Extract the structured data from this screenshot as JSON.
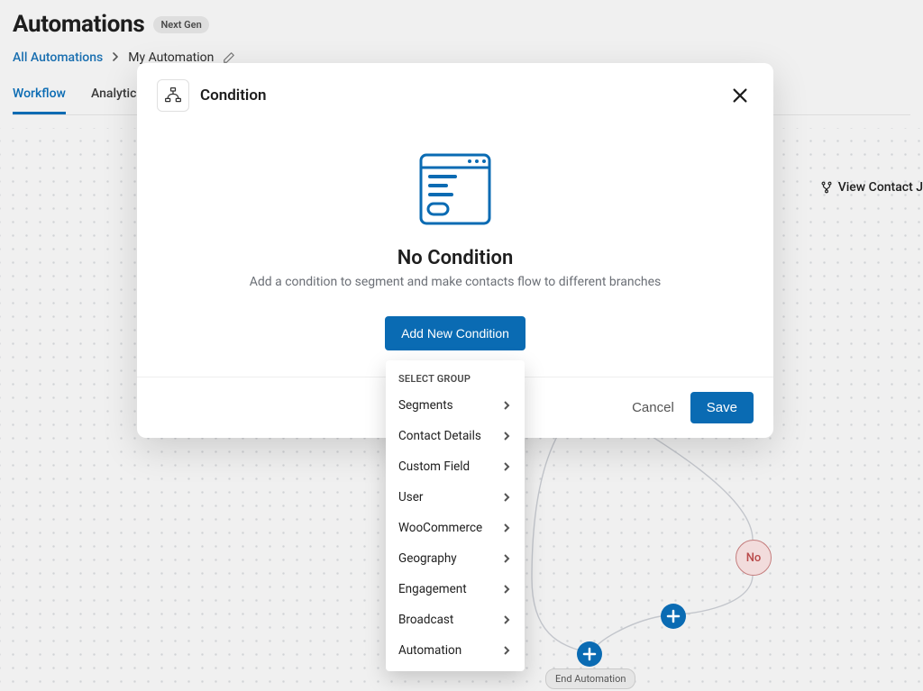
{
  "header": {
    "title": "Automations",
    "badge": "Next Gen"
  },
  "breadcrumb": {
    "root": "All Automations",
    "current": "My Automation"
  },
  "tabs": {
    "workflow": "Workflow",
    "analytics": "Analytics"
  },
  "toolbar": {
    "view_contact": "View Contact J"
  },
  "modal": {
    "title": "Condition",
    "empty_title": "No Condition",
    "empty_subtitle": "Add a condition to segment and make contacts flow to different branches",
    "add_button": "Add New Condition",
    "cancel": "Cancel",
    "save": "Save"
  },
  "dropdown": {
    "group_label": "SELECT GROUP",
    "items": [
      "Segments",
      "Contact Details",
      "Custom Field",
      "User",
      "WooCommerce",
      "Geography",
      "Engagement",
      "Broadcast",
      "Automation"
    ]
  },
  "flow": {
    "no_label": "No",
    "end_label": "End Automation"
  }
}
